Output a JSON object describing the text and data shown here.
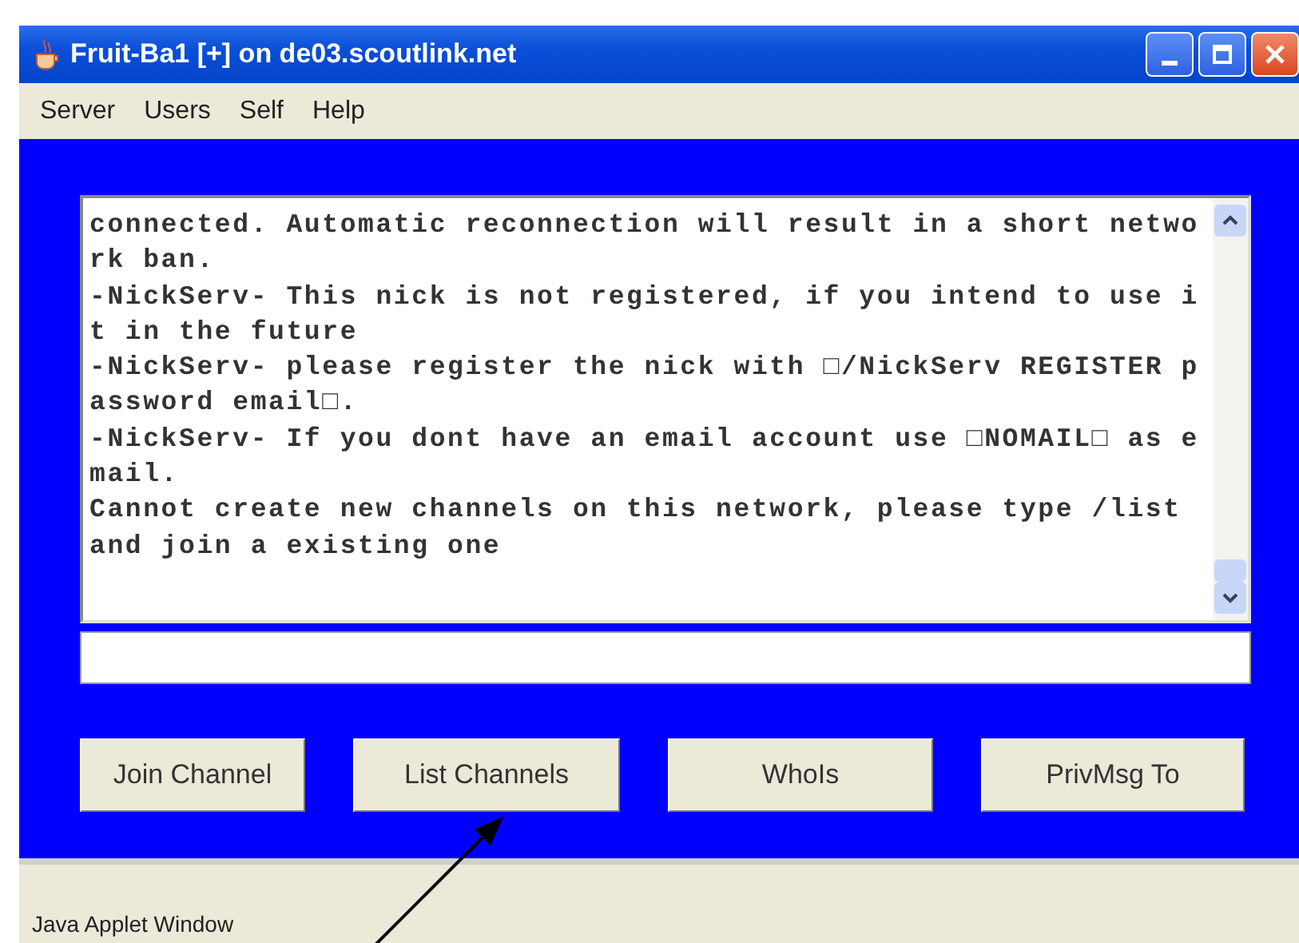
{
  "window": {
    "title": "Fruit-Ba1 [+] on de03.scoutlink.net"
  },
  "menu": [
    "Server",
    "Users",
    "Self",
    "Help"
  ],
  "log_lines": [
    "connected. Automatic reconnection will result in a short netwo",
    "rk ban.",
    "-NickServ- This nick is not registered, if you intend to use i",
    "t in the future",
    "-NickServ- please register the nick with □/NickServ REGISTER p",
    "assword email□.",
    "-NickServ- If you dont have an email account use □NOMAIL□ as e",
    "mail.",
    "Cannot create new channels on this network, please type /list",
    "and join a existing one"
  ],
  "buttons": [
    "Join Channel",
    "List Channels",
    "WhoIs",
    "PrivMsg To"
  ],
  "status_bar": "Java Applet Window"
}
